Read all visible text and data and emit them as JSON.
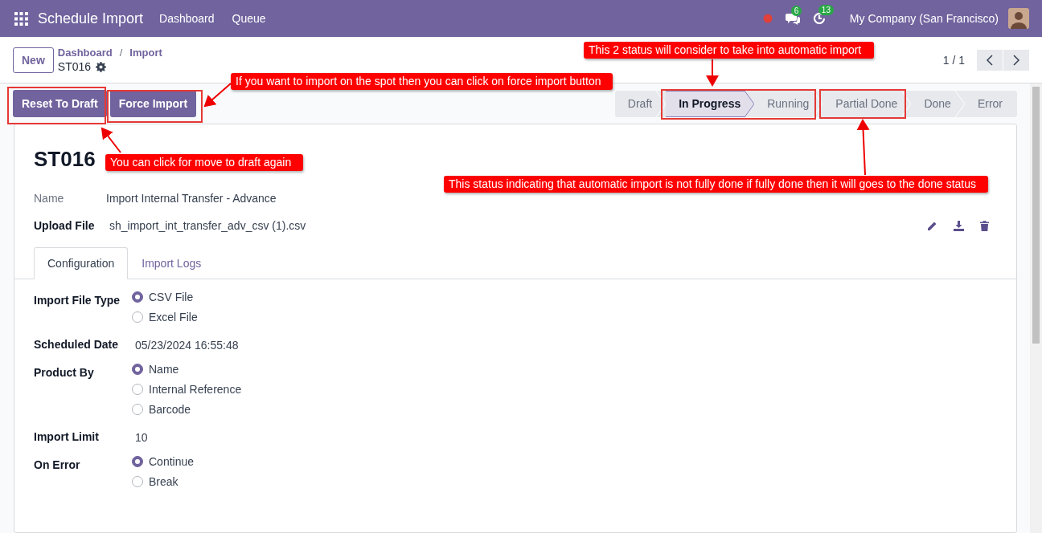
{
  "navbar": {
    "app_title": "Schedule Import",
    "menu": [
      "Dashboard",
      "Queue"
    ],
    "chat_count": "6",
    "activity_count": "13",
    "company": "My Company (San Francisco)"
  },
  "control_panel": {
    "new_button": "New",
    "breadcrumb": [
      "Dashboard",
      "Import"
    ],
    "separator": "/",
    "record": "ST016",
    "pager": "1 / 1"
  },
  "actions": [
    "Reset To Draft",
    "Force Import"
  ],
  "statusbar": [
    {
      "label": "Draft",
      "selected": false
    },
    {
      "label": "In Progress",
      "selected": true
    },
    {
      "label": "Running",
      "selected": false
    },
    {
      "label": "Partial Done",
      "selected": false
    },
    {
      "label": "Done",
      "selected": false
    },
    {
      "label": "Error",
      "selected": false
    }
  ],
  "record": {
    "title": "ST016",
    "fields": [
      {
        "label": "Name",
        "value": "Import Internal Transfer - Advance",
        "kind": "muted"
      },
      {
        "label": "Upload File",
        "value": "sh_import_int_transfer_adv_csv (1).csv",
        "kind": "file"
      }
    ]
  },
  "tabs": [
    {
      "label": "Configuration",
      "selected": true
    },
    {
      "label": "Import Logs",
      "selected": false
    }
  ],
  "configuration": [
    {
      "label": "Import File Type",
      "kind": "radio",
      "options": [
        {
          "label": "CSV File",
          "selected": true
        },
        {
          "label": "Excel File",
          "selected": false
        }
      ]
    },
    {
      "label": "Scheduled Date",
      "kind": "text",
      "value": "05/23/2024 16:55:48"
    },
    {
      "label": "Product By",
      "kind": "radio",
      "options": [
        {
          "label": "Name",
          "selected": true
        },
        {
          "label": "Internal Reference",
          "selected": false
        },
        {
          "label": "Barcode",
          "selected": false
        }
      ]
    },
    {
      "label": "Import Limit",
      "kind": "text",
      "value": "10"
    },
    {
      "label": "On Error",
      "kind": "radio",
      "options": [
        {
          "label": "Continue",
          "selected": true
        },
        {
          "label": "Break",
          "selected": false
        }
      ]
    }
  ],
  "annotations": [
    {
      "text": "This 2 status will consider to take into automatic import"
    },
    {
      "text": "If you want to import on the spot then you can click on force import button"
    },
    {
      "text": "You can click for move to draft again"
    },
    {
      "text": "This status indicating that automatic import is not fully done if fully done then it will goes to the done status"
    }
  ]
}
